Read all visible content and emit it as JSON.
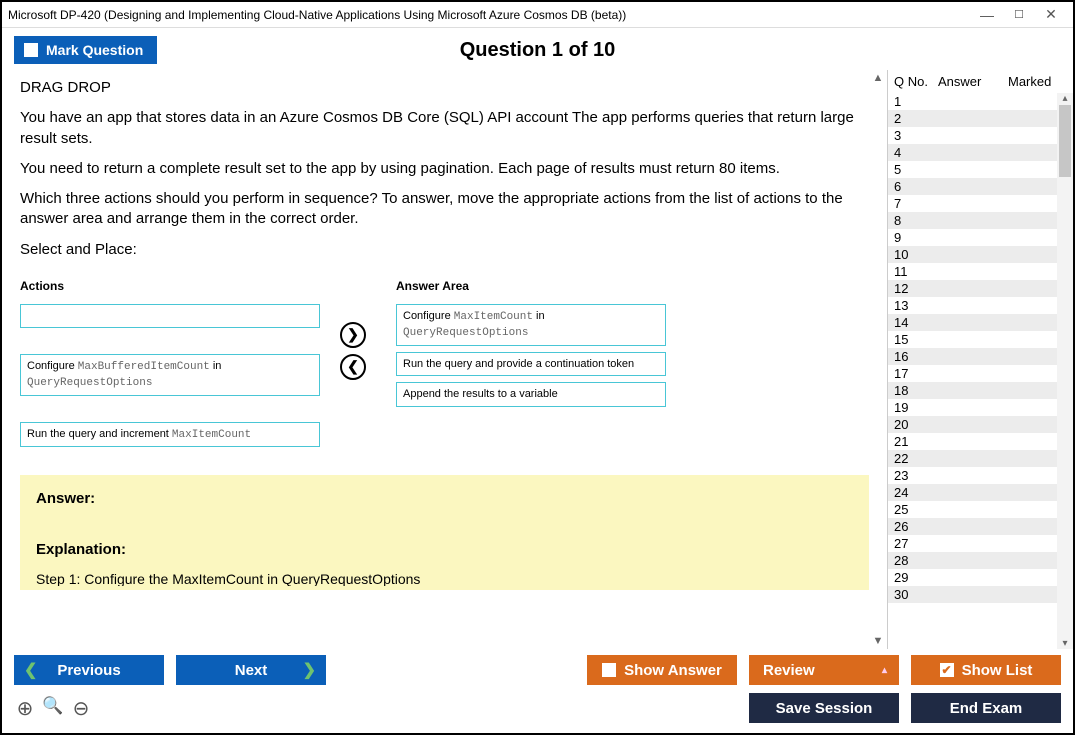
{
  "window": {
    "title": "Microsoft DP-420 (Designing and Implementing Cloud-Native Applications Using Microsoft Azure Cosmos DB (beta))"
  },
  "header": {
    "mark_label": "Mark Question",
    "counter": "Question 1 of 10"
  },
  "question": {
    "type_label": "DRAG DROP",
    "p1": "You have an app that stores data in an Azure Cosmos DB Core (SQL) API account The app performs queries that return large result sets.",
    "p2": "You need to return a complete result set to the app by using pagination. Each page of results must return 80 items.",
    "p3": "Which three actions should you perform in sequence? To answer, move the appropriate actions from the list of actions to the answer area and arrange them in the correct order.",
    "p4": "Select and Place:",
    "actions_header": "Actions",
    "answer_header": "Answer Area",
    "actions": {
      "slot1_pre": "Configure ",
      "slot1_code": "MaxBufferedItemCount",
      "slot1_mid": " in ",
      "slot1_code2": "QueryRequestOptions",
      "slot2_pre": "Run the query and increment ",
      "slot2_code": "MaxItemCount"
    },
    "answers": {
      "a1_pre": "Configure ",
      "a1_code": "MaxItemCount",
      "a1_mid": " in ",
      "a1_code2": "QueryRequestOptions",
      "a2": "Run the query and provide a continuation token",
      "a3": "Append the results to a variable"
    },
    "answer_block": {
      "answer_h": "Answer:",
      "explanation_h": "Explanation:",
      "step1": "Step 1: Configure the MaxItemCount in QueryRequestOptions"
    }
  },
  "rpanel": {
    "h1": "Q No.",
    "h2": "Answer",
    "h3": "Marked",
    "rows": [
      "1",
      "2",
      "3",
      "4",
      "5",
      "6",
      "7",
      "8",
      "9",
      "10",
      "11",
      "12",
      "13",
      "14",
      "15",
      "16",
      "17",
      "18",
      "19",
      "20",
      "21",
      "22",
      "23",
      "24",
      "25",
      "26",
      "27",
      "28",
      "29",
      "30"
    ]
  },
  "buttons": {
    "previous": "Previous",
    "next": "Next",
    "show_answer": "Show Answer",
    "review": "Review",
    "show_list": "Show List",
    "save_session": "Save Session",
    "end_exam": "End Exam"
  },
  "icons": {
    "arrow_right": "❯",
    "arrow_left": "❮",
    "check": "✔",
    "caret_up": "▴",
    "caret_down": "▾",
    "min": "—",
    "max": "☐",
    "close": "✕",
    "zoom_in": "⊕",
    "search": "🔍",
    "zoom_out": "⊖",
    "tri_up": "▲",
    "tri_down": "▼"
  }
}
